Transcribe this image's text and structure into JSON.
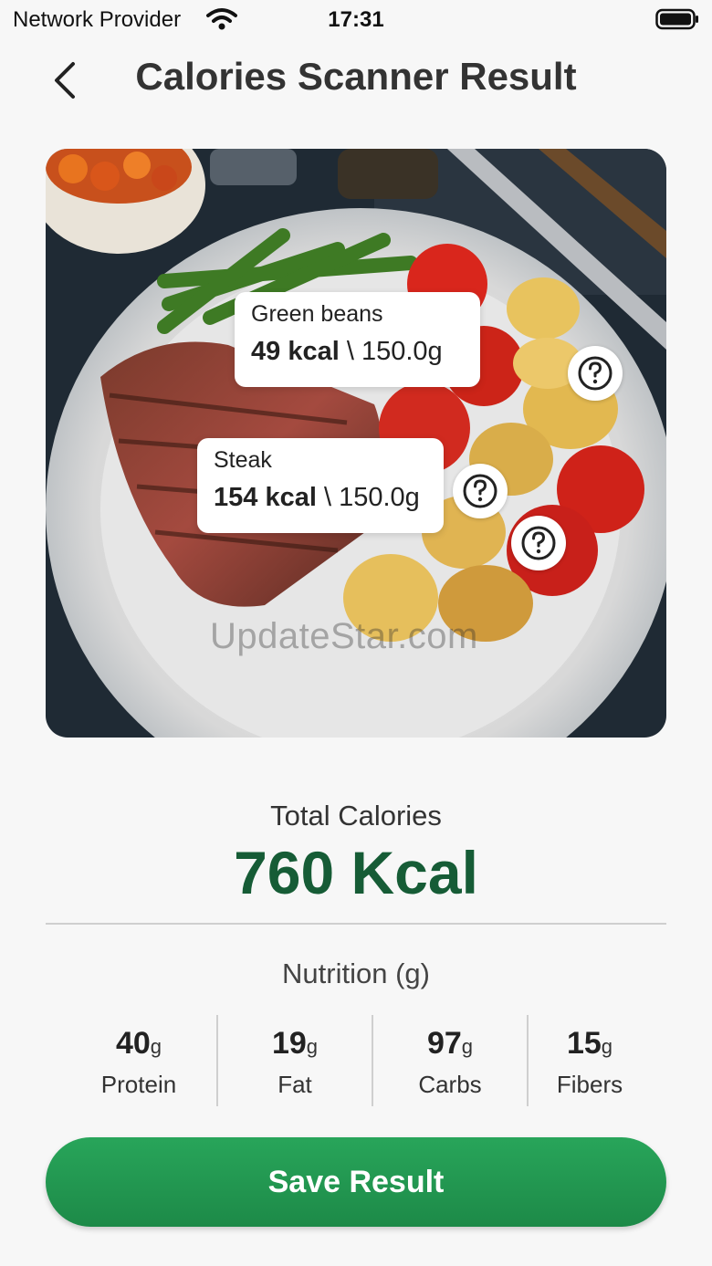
{
  "status_bar": {
    "carrier": "Network Provider",
    "time": "17:31"
  },
  "header": {
    "title": "Calories Scanner Result",
    "back_icon": "chevron-left-icon"
  },
  "photo": {
    "watermark": "UpdateStar.com",
    "detected_items": [
      {
        "name": "Green beans",
        "kcal": "49 kcal",
        "weight": "150.0g",
        "separator": "\\"
      },
      {
        "name": "Steak",
        "kcal": "154 kcal",
        "weight": "150.0g",
        "separator": "\\"
      }
    ],
    "help_icon": "question-circle-icon"
  },
  "totals": {
    "label": "Total Calories",
    "value": "760 Kcal"
  },
  "nutrition": {
    "title": "Nutrition (g)",
    "unit": "g",
    "items": [
      {
        "value": "40",
        "label": "Protein"
      },
      {
        "value": "19",
        "label": "Fat"
      },
      {
        "value": "97",
        "label": "Carbs"
      },
      {
        "value": "15",
        "label": "Fibers"
      }
    ]
  },
  "actions": {
    "save_label": "Save Result"
  },
  "colors": {
    "accent_green": "#1d8a48",
    "total_text": "#165c36",
    "background": "#f7f7f7"
  }
}
